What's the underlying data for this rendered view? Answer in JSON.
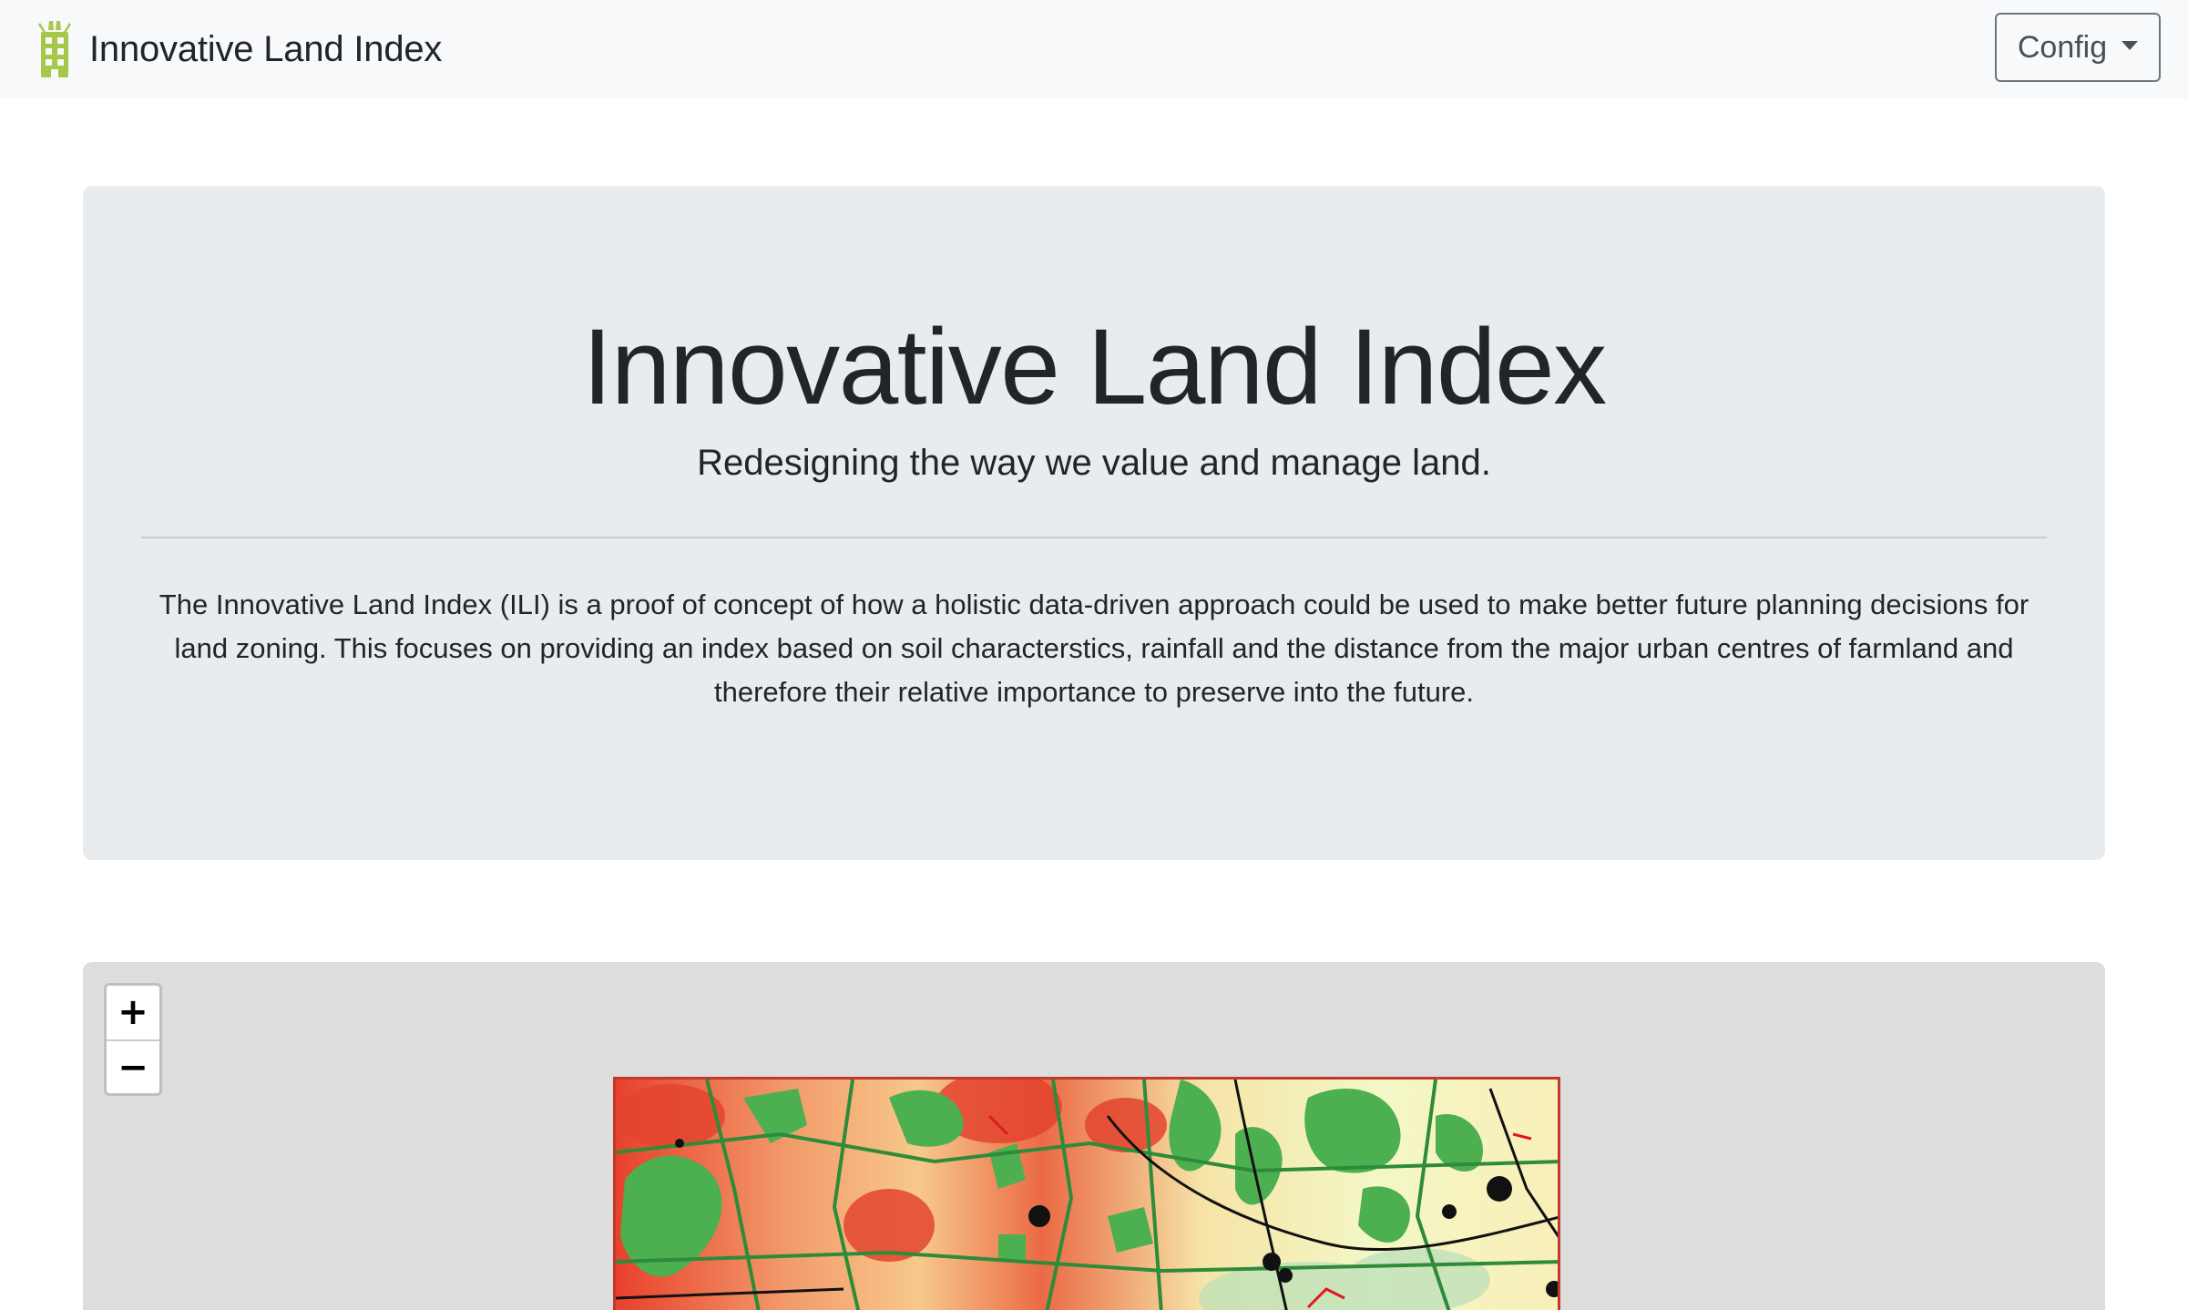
{
  "navbar": {
    "brand_text": "Innovative Land Index",
    "brand_icon": "building-icon",
    "brand_icon_color": "#a6c84a",
    "config_label": "Config"
  },
  "jumbotron": {
    "title": "Innovative Land Index",
    "lead": "Redesigning the way we value and manage land.",
    "description": "The Innovative Land Index (ILI) is a proof of concept of how a holistic data-driven approach could be used to make better future planning decisions for land zoning. This focuses on providing an index based on soil characterstics, rainfall and the distance from the major urban centres of farmland and therefore their relative importance to preserve into the future."
  },
  "map": {
    "zoom_in_label": "+",
    "zoom_out_label": "−",
    "colors": {
      "index_high": "#e8412c",
      "index_mid": "#f7c98b",
      "index_low": "#f3f7c6",
      "protected": "#4caf50",
      "urban": "#000000",
      "boundary": "#c0392b"
    }
  }
}
